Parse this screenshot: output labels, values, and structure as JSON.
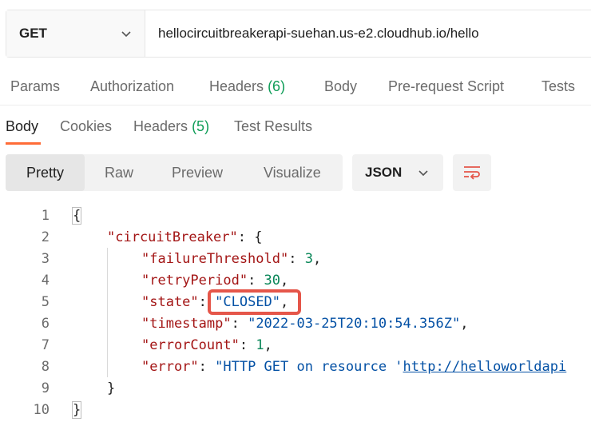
{
  "request": {
    "method": "GET",
    "url": "hellocircuitbreakerapi-suehan.us-e2.cloudhub.io/hello"
  },
  "request_tabs": {
    "params": "Params",
    "authorization": "Authorization",
    "headers": "Headers",
    "headers_count": "(6)",
    "body": "Body",
    "prerequest": "Pre-request Script",
    "tests": "Tests"
  },
  "response_tabs": {
    "body": "Body",
    "cookies": "Cookies",
    "headers": "Headers",
    "headers_count": "(5)",
    "test_results": "Test Results"
  },
  "view": {
    "pretty": "Pretty",
    "raw": "Raw",
    "preview": "Preview",
    "visualize": "Visualize",
    "format": "JSON"
  },
  "code": {
    "line_numbers": [
      "1",
      "2",
      "3",
      "4",
      "5",
      "6",
      "7",
      "8",
      "9",
      "10"
    ],
    "open_brace": "{",
    "close_brace": "}",
    "cb_key": "\"circuitBreaker\"",
    "cb_open": ": {",
    "cb_close": "}",
    "ft_key": "\"failureThreshold\"",
    "ft_val": "3",
    "rp_key": "\"retryPeriod\"",
    "rp_val": "30",
    "state_key": "\"state\"",
    "state_val": "\"CLOSED\"",
    "ts_key": "\"timestamp\"",
    "ts_val": "\"2022-03-25T20:10:54.356Z\"",
    "ec_key": "\"errorCount\"",
    "ec_val": "1",
    "err_key": "\"error\"",
    "err_val": "\"HTTP GET on resource '",
    "err_link": "http://helloworldapi"
  }
}
